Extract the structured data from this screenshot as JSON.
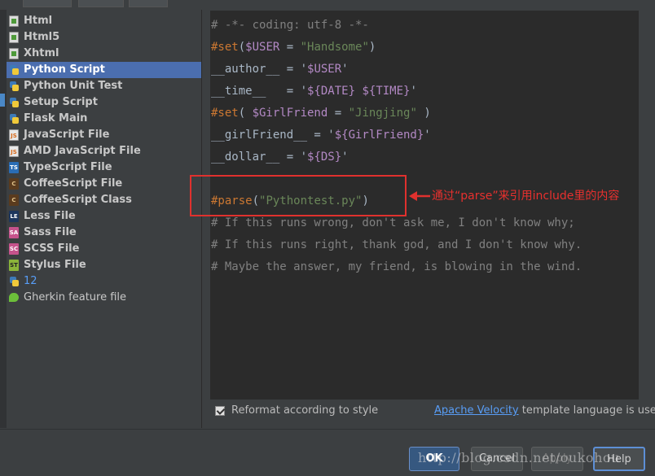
{
  "templates": [
    {
      "label": "Html",
      "icon": "html-file-icon"
    },
    {
      "label": "Html5",
      "icon": "html5-file-icon"
    },
    {
      "label": "Xhtml",
      "icon": "xhtml-file-icon"
    },
    {
      "label": "Python Script",
      "icon": "python-icon",
      "selected": true
    },
    {
      "label": "Python Unit Test",
      "icon": "python-icon"
    },
    {
      "label": "Setup Script",
      "icon": "python-icon"
    },
    {
      "label": "Flask Main",
      "icon": "python-icon"
    },
    {
      "label": "JavaScript File",
      "icon": "javascript-file-icon"
    },
    {
      "label": "AMD JavaScript File",
      "icon": "javascript-file-icon"
    },
    {
      "label": "TypeScript File",
      "icon": "typescript-file-icon"
    },
    {
      "label": "CoffeeScript File",
      "icon": "coffeescript-file-icon"
    },
    {
      "label": "CoffeeScript Class",
      "icon": "coffeescript-file-icon"
    },
    {
      "label": "Less File",
      "icon": "less-file-icon"
    },
    {
      "label": "Sass File",
      "icon": "sass-file-icon"
    },
    {
      "label": "SCSS File",
      "icon": "scss-file-icon"
    },
    {
      "label": "Stylus File",
      "icon": "stylus-file-icon"
    },
    {
      "label": "12",
      "icon": "python-icon"
    },
    {
      "label": "Gherkin feature file",
      "icon": "gherkin-file-icon"
    }
  ],
  "code": {
    "l1": "# -*- coding: utf-8 -*-",
    "l2a": "#set",
    "l2b": "(",
    "l2c": "$USER",
    "l2d": " = ",
    "l2e": "\"Handsome\"",
    "l2f": ")",
    "l3a": "__author__ = '",
    "l3b": "$USER",
    "l3c": "'",
    "l4a": "__time__   = '",
    "l4b": "${DATE}",
    "l4c": " ",
    "l4d": "${TIME}",
    "l4e": "'",
    "l5a": "#set",
    "l5b": "( ",
    "l5c": "$GirlFriend",
    "l5d": " = ",
    "l5e": "\"Jingjing\"",
    "l5f": " )",
    "l6a": "__girlFriend__ = '",
    "l6b": "${GirlFriend}",
    "l6c": "'",
    "l7a": "__dollar__ = '",
    "l7b": "${DS}",
    "l7c": "'",
    "l9a": "#parse",
    "l9b": "(",
    "l9c": "\"Pythontest.py\"",
    "l9d": ")",
    "l10": "# If this runs wrong, don't ask me, I don't know why;",
    "l11": "# If this runs right, thank god, and I don't know why.",
    "l12": "# Maybe the answer, my friend, is blowing in the wind."
  },
  "annotation": "通过“parse”来引用include里的内容",
  "options": {
    "reformat_label": "Reformat according to style",
    "reformat_checked": true,
    "velocity_link": "Apache Velocity",
    "velocity_suffix": " template language is used"
  },
  "buttons": {
    "ok": "OK",
    "cancel": "Cancel",
    "apply": "Apply",
    "help": "Help"
  },
  "watermark": "http://blog.csdn.net/oukohou",
  "colors": {
    "selected_bg": "#4b6eaf",
    "annotation_red": "#e0312e",
    "link_blue": "#589df6"
  }
}
